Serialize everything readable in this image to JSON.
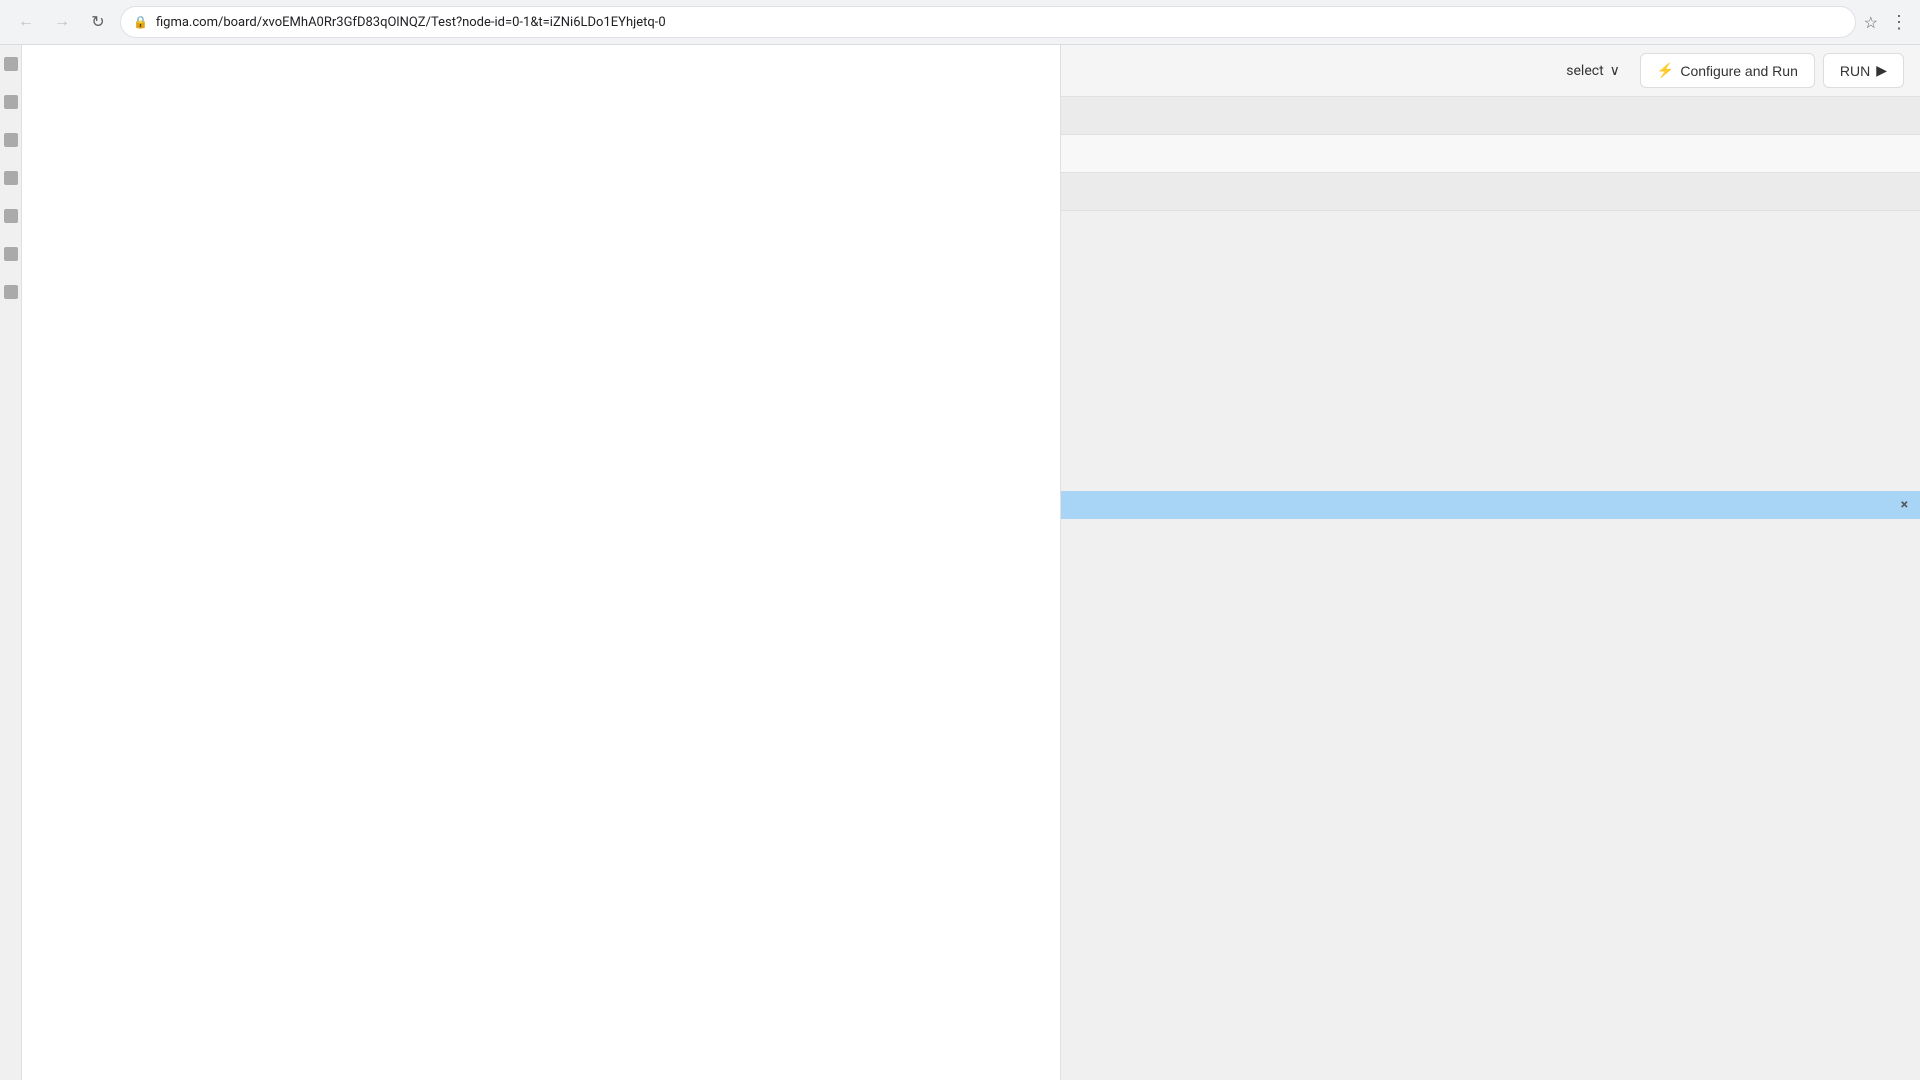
{
  "browser": {
    "url": "figma.com/board/xvoEMhA0Rr3GfD83qOlNQZ/Test?node-id=0-1&t=iZNi6LDo1EYhjetq-0",
    "star_icon": "☆",
    "menu_icon": "⋮",
    "back_icon": "←",
    "forward_icon": "→",
    "refresh_icon": "↻",
    "lock_icon": "🔒"
  },
  "toolbar": {
    "select_label": "select",
    "select_chevron": "∨",
    "configure_run_label": "Configure and Run",
    "configure_run_icon": "⚡",
    "run_label": "RUN",
    "run_icon": "▶"
  },
  "panel": {
    "close_icon": "×"
  }
}
